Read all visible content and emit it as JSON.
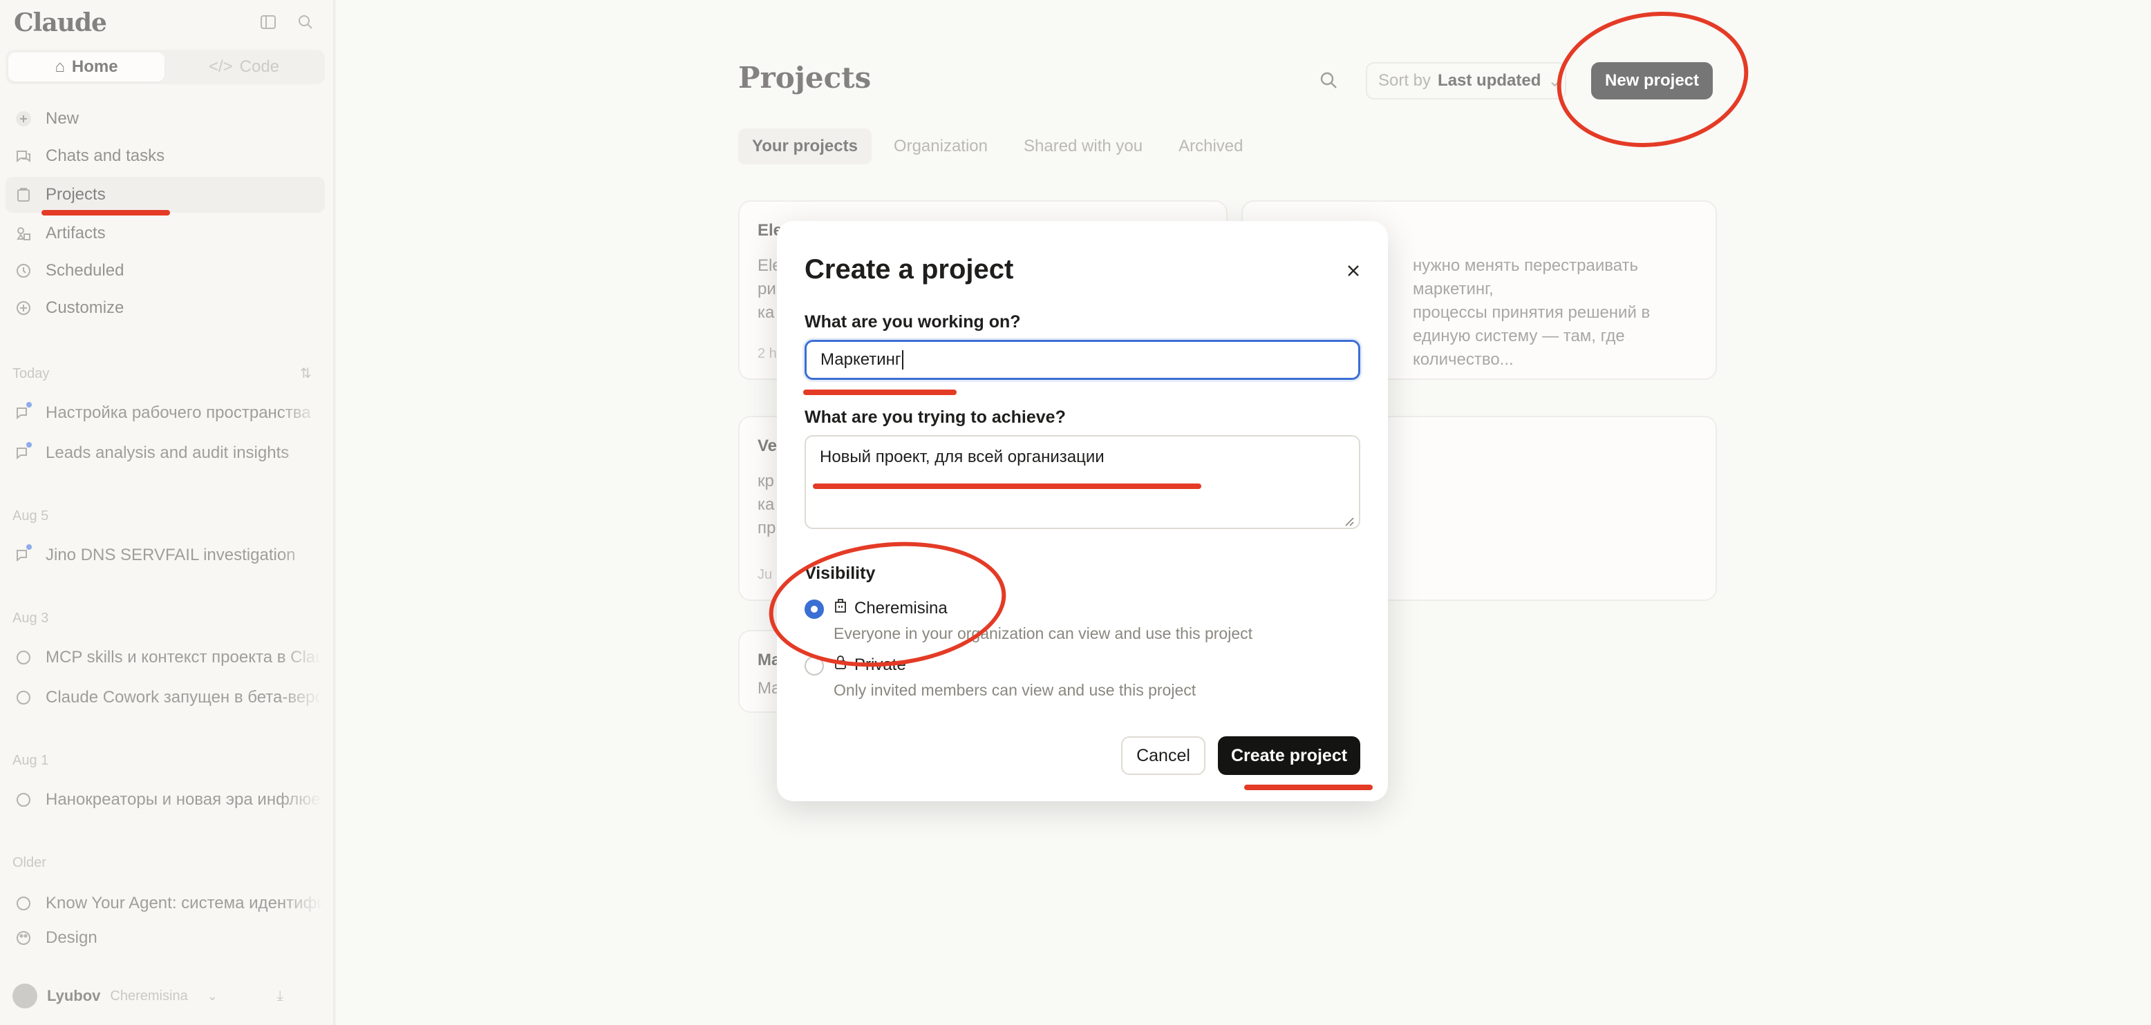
{
  "sidebar": {
    "brand": "Claude",
    "modes": {
      "home": "Home",
      "code": "Code"
    },
    "nav": [
      {
        "label": "New",
        "icon": "plus-icon"
      },
      {
        "label": "Chats and tasks",
        "icon": "chat-icon"
      },
      {
        "label": "Projects",
        "icon": "folder-icon",
        "active": true
      },
      {
        "label": "Artifacts",
        "icon": "artifacts-icon"
      },
      {
        "label": "Scheduled",
        "icon": "clock-icon"
      },
      {
        "label": "Customize",
        "icon": "customize-icon"
      }
    ],
    "sections": {
      "today": "Today",
      "aug5": "Aug 5",
      "aug3": "Aug 3",
      "aug1": "Aug 1",
      "older": "Older"
    },
    "chats": {
      "today": [
        "Настройка рабочего пространства",
        "Leads analysis and audit insights"
      ],
      "aug5": [
        "Jino DNS SERVFAIL investigation"
      ],
      "aug3": [
        "MCP skills и контекст проекта в Claude",
        "Claude Cowork запущен в бета-версии"
      ],
      "aug1": [
        "Нанокреаторы и новая эра инфлюенсеров"
      ],
      "older": [
        "Know Your Agent: система идентификации",
        "Design"
      ]
    },
    "user": {
      "name": "Lyubov",
      "org": "Cheremisina"
    }
  },
  "main": {
    "title": "Projects",
    "sort": {
      "prefix": "Sort by",
      "value": "Last updated"
    },
    "new_project": "New project",
    "tabs": [
      "Your projects",
      "Organization",
      "Shared with you",
      "Archived"
    ],
    "cards": [
      {
        "title": "Ele",
        "desc": "Ele\nри\nка",
        "meta": "2 h"
      },
      {
        "title": "",
        "desc": "нужно менять перестраивать маркетинг,\nпроцессы принятия решений в\nединую систему — там, где количество...",
        "meta": ""
      },
      {
        "title": "Ve",
        "desc": "кр\nка\nпр",
        "meta": "Ju"
      },
      {
        "title": "Ma",
        "desc": "Ma",
        "meta": ""
      }
    ]
  },
  "modal": {
    "title": "Create a project",
    "q1": "What are you working on?",
    "q1_value": "Маркетинг",
    "q2": "What are you trying to achieve?",
    "q2_value": "Новый проект, для всей организации",
    "visibility_label": "Visibility",
    "options": [
      {
        "label": "Cheremisina",
        "desc": "Everyone in your organization can view and use this project",
        "checked": true
      },
      {
        "label": "Private",
        "desc": "Only invited members can view and use this project",
        "checked": false
      }
    ],
    "cancel": "Cancel",
    "create": "Create project"
  },
  "colors": {
    "accent": "#3b6fd3",
    "annotation": "#e43b26",
    "primary_button": "#141413"
  }
}
